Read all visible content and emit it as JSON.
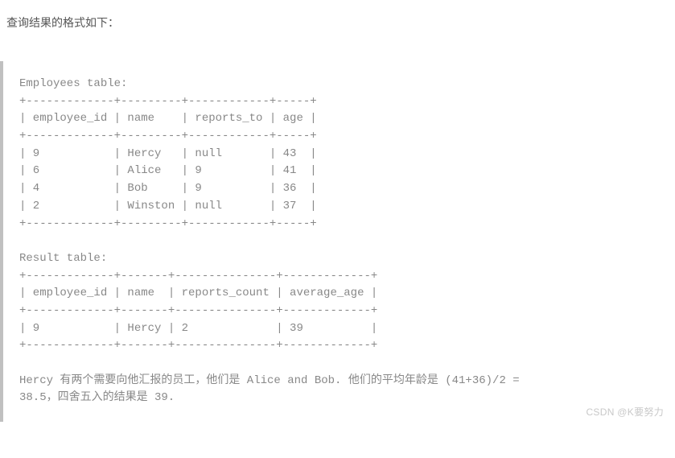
{
  "intro": "查询结果的格式如下：",
  "code": {
    "t1_header": "Employees table:",
    "t1_cols": [
      "employee_id",
      "name",
      "reports_to",
      "age"
    ],
    "t1_sep": "+-------------+---------+------------+-----+",
    "t1_head": "| employee_id | name    | reports_to | age |",
    "t1_r1": "| 9           | Hercy   | null       | 43  |",
    "t1_r2": "| 6           | Alice   | 9          | 41  |",
    "t1_r3": "| 4           | Bob     | 9          | 36  |",
    "t1_r4": "| 2           | Winston | null       | 37  |",
    "t1_data": [
      {
        "employee_id": 9,
        "name": "Hercy",
        "reports_to": null,
        "age": 43
      },
      {
        "employee_id": 6,
        "name": "Alice",
        "reports_to": 9,
        "age": 41
      },
      {
        "employee_id": 4,
        "name": "Bob",
        "reports_to": 9,
        "age": 36
      },
      {
        "employee_id": 2,
        "name": "Winston",
        "reports_to": null,
        "age": 37
      }
    ],
    "t2_header": "Result table:",
    "t2_cols": [
      "employee_id",
      "name",
      "reports_count",
      "average_age"
    ],
    "t2_sep": "+-------------+-------+---------------+-------------+",
    "t2_head": "| employee_id | name  | reports_count | average_age |",
    "t2_r1": "| 9           | Hercy | 2             | 39          |",
    "t2_data": [
      {
        "employee_id": 9,
        "name": "Hercy",
        "reports_count": 2,
        "average_age": 39
      }
    ],
    "explain1": "Hercy 有两个需要向他汇报的员工，他们是 Alice and Bob. 他们的平均年龄是 (41+36)/2 = ",
    "explain2": "38.5，四舍五入的结果是 39."
  },
  "watermark": "CSDN @K要努力"
}
